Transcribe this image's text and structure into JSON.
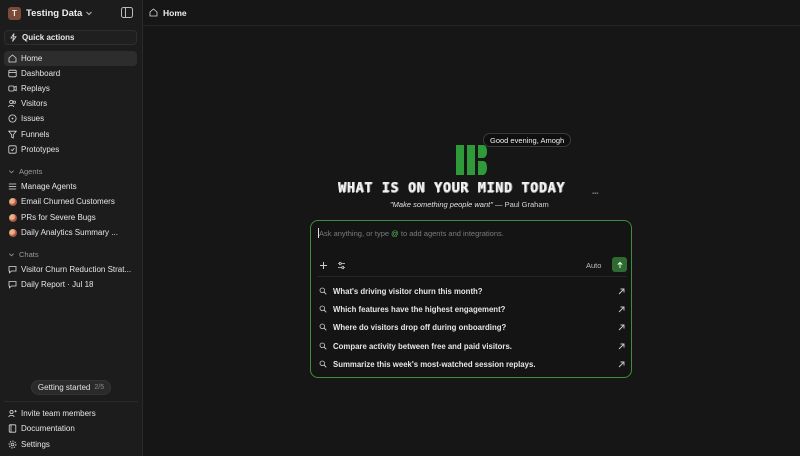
{
  "workspace": {
    "avatar_letter": "T",
    "name": "Testing Data"
  },
  "sidebar": {
    "quick_actions": "Quick actions",
    "nav": [
      {
        "label": "Home",
        "icon": "home-icon",
        "active": true
      },
      {
        "label": "Dashboard",
        "icon": "dashboard-icon"
      },
      {
        "label": "Replays",
        "icon": "replay-icon"
      },
      {
        "label": "Visitors",
        "icon": "visitors-icon"
      },
      {
        "label": "Issues",
        "icon": "issues-icon"
      },
      {
        "label": "Funnels",
        "icon": "funnel-icon"
      },
      {
        "label": "Prototypes",
        "icon": "prototype-icon"
      }
    ],
    "agents_title": "Agents",
    "agents": [
      {
        "label": "Manage Agents"
      },
      {
        "label": "Email Churned Customers"
      },
      {
        "label": "PRs for Severe Bugs"
      },
      {
        "label": "Daily Analytics Summary ..."
      }
    ],
    "chats_title": "Chats",
    "chats": [
      {
        "label": "Visitor Churn Reduction Strat..."
      },
      {
        "label": "Daily Report · Jul 18"
      }
    ],
    "getting_started": {
      "label": "Getting started",
      "count": "2/5"
    },
    "footer": [
      {
        "label": "Invite team members"
      },
      {
        "label": "Documentation"
      },
      {
        "label": "Settings"
      }
    ]
  },
  "topbar": {
    "title": "Home"
  },
  "hero": {
    "greeting": "Good evening, Amogh",
    "headline": "WHAT IS ON YOUR MIND TODAY",
    "quote": "\"Make something people want\"",
    "author": "— Paul Graham"
  },
  "composer": {
    "placeholder_before": "Ask anything, or type",
    "placeholder_at": "@",
    "placeholder_after": "to add agents and integrations.",
    "mode": "Auto"
  },
  "suggestions": [
    "What's driving visitor churn this month?",
    "Which features have the highest engagement?",
    "Where do visitors drop off during onboarding?",
    "Compare activity between free and paid visitors.",
    "Summarize this week's most-watched session replays."
  ],
  "colors": {
    "accent": "#3f8d3f",
    "send_bg": "#2e6a31",
    "logo_green": "#2f9a3a"
  }
}
